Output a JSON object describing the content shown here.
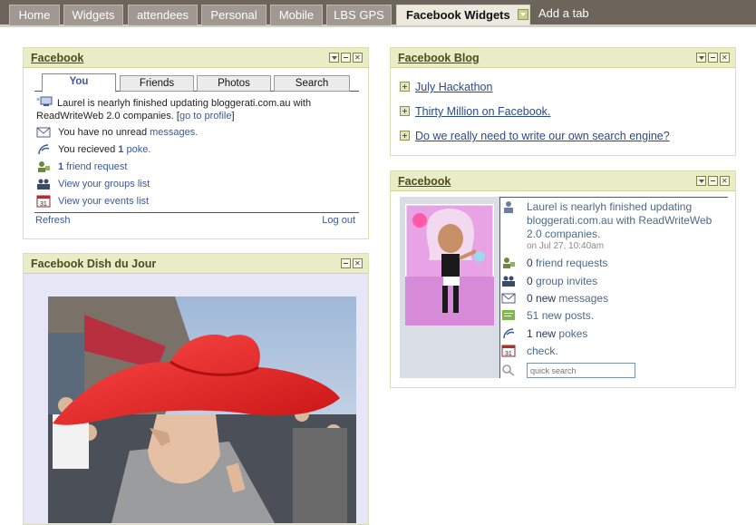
{
  "tabs": [
    {
      "label": "Home",
      "active": false
    },
    {
      "label": "Widgets",
      "active": false
    },
    {
      "label": "attendees",
      "active": false
    },
    {
      "label": "Personal",
      "active": false
    },
    {
      "label": "Mobile",
      "active": false
    },
    {
      "label": "LBS GPS",
      "active": false
    },
    {
      "label": "Facebook Widgets",
      "active": true
    }
  ],
  "add_tab": "Add a tab",
  "fb_widget": {
    "title": "Facebook",
    "subtabs": [
      "You",
      "Friends",
      "Photos",
      "Search"
    ],
    "status_text": "Laurel is nearlyh finished updating bloggerati.com.au with ReadWriteWeb 2.0 companies.",
    "status_link": "go to profile",
    "messages_prefix": "You have no unread",
    "messages_link": "messages.",
    "poke_prefix": "You recieved",
    "poke_count": "1",
    "poke_link": "poke.",
    "friend_req_count": "1",
    "friend_req_link": "friend request",
    "groups_link": "View your groups list",
    "events_link": "View your events list",
    "refresh": "Refresh",
    "logout": "Log out"
  },
  "dish": {
    "title": "Facebook Dish du Jour"
  },
  "blog": {
    "title": "Facebook Blog",
    "items": [
      "July Hackathon",
      "Thirty Million on Facebook.",
      "Do we really need to write our own search engine?"
    ]
  },
  "fb2": {
    "title": "Facebook",
    "status": "Laurel is nearlyh finished updating bloggerati.com.au with ReadWriteWeb 2.0 companies.",
    "date": "on Jul 27, 10:40am",
    "friend_requests": {
      "n": "0",
      "label": "friend requests"
    },
    "group_invites": {
      "n": "0",
      "label": "group invites"
    },
    "messages": {
      "n": "0",
      "new": "new",
      "label": "messages"
    },
    "posts": {
      "n": "51",
      "label": "new posts."
    },
    "pokes": {
      "n": "1",
      "new": "new",
      "label": "pokes"
    },
    "events": "check.",
    "search_placeholder": "quick search"
  },
  "colors": {
    "topbar": "#6d645c",
    "tab": "#a19891",
    "panel_head": "#e9edc7",
    "fb_blue": "#3b5998"
  }
}
